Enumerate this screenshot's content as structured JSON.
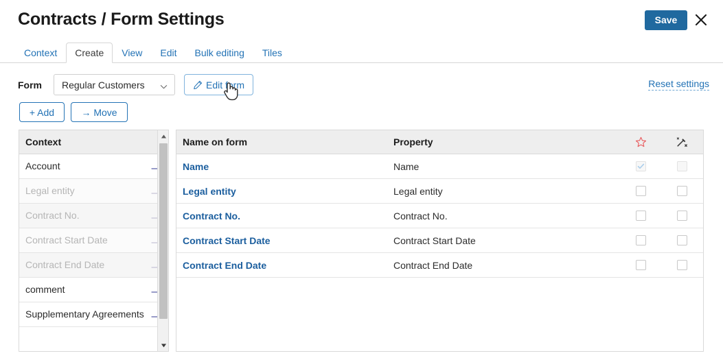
{
  "header": {
    "title": "Contracts / Form Settings",
    "save_label": "Save",
    "close_icon": "close-icon"
  },
  "tabs": [
    {
      "label": "Context",
      "active": false
    },
    {
      "label": "Create",
      "active": true
    },
    {
      "label": "View",
      "active": false
    },
    {
      "label": "Edit",
      "active": false
    },
    {
      "label": "Bulk editing",
      "active": false
    },
    {
      "label": "Tiles",
      "active": false
    }
  ],
  "toolbar": {
    "form_label": "Form",
    "form_value": "Regular Customers",
    "edit_form_label": "Edit form",
    "edit_form_icon": "pencil-icon",
    "reset_settings_label": "Reset settings",
    "add_label": "+ Add",
    "move_label": "→ Move"
  },
  "sidebar": {
    "title": "Context",
    "items": [
      {
        "label": "Account",
        "disabled": false
      },
      {
        "label": "Legal entity",
        "disabled": true
      },
      {
        "label": "Contract No.",
        "disabled": true
      },
      {
        "label": "Contract Start Date",
        "disabled": true
      },
      {
        "label": "Contract End Date",
        "disabled": true
      },
      {
        "label": "comment",
        "disabled": false
      },
      {
        "label": "Supplementary Agreements",
        "disabled": false
      }
    ],
    "arrow_icon": "arrow-right-icon",
    "scrollbar": {
      "up_icon": "triangle-up-icon",
      "down_icon": "triangle-down-icon"
    }
  },
  "table": {
    "columns": {
      "name": "Name on form",
      "property": "Property",
      "favorite_icon": "star-icon",
      "magic_icon": "magic-wand-icon"
    },
    "rows": [
      {
        "name": "Name",
        "property": "Name",
        "favorite": true,
        "favorite_disabled": true,
        "magic": false,
        "magic_disabled": true
      },
      {
        "name": "Legal entity",
        "property": "Legal entity",
        "favorite": false,
        "favorite_disabled": false,
        "magic": false,
        "magic_disabled": false
      },
      {
        "name": "Contract No.",
        "property": "Contract No.",
        "favorite": false,
        "favorite_disabled": false,
        "magic": false,
        "magic_disabled": false
      },
      {
        "name": "Contract Start Date",
        "property": "Contract Start Date",
        "favorite": false,
        "favorite_disabled": false,
        "magic": false,
        "magic_disabled": false
      },
      {
        "name": "Contract End Date",
        "property": "Contract End Date",
        "favorite": false,
        "favorite_disabled": false,
        "magic": false,
        "magic_disabled": false
      }
    ]
  },
  "colors": {
    "accent_blue": "#2272b5",
    "save_blue": "#20699f",
    "link_blue": "#1b5e9e",
    "star_red": "#e8575a",
    "header_gray": "#eeeeee"
  },
  "cursor": {
    "type": "pointer-hand"
  }
}
